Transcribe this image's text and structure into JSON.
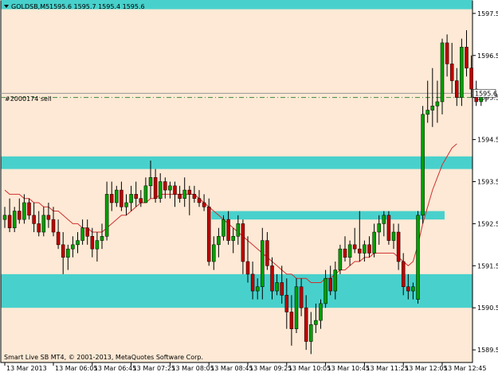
{
  "header": {
    "menu_icon": "triangle-down-icon",
    "symbol": "GOLDSB,M5",
    "ohlc": "1595.6 1595.7 1595.4 1595.6"
  },
  "footer": {
    "copyright": "Smart Live SB MT4, © 2001-2013, MetaQuotes Software Corp."
  },
  "trade_label": "#2000174 sell",
  "colors": {
    "background": "#fde9d5",
    "zone": "#48d1cc",
    "bull": "#00a000",
    "bear": "#c00000",
    "moving_average": "#d03030",
    "trade_line": "#3a8a3a",
    "bid_line": "#999999"
  },
  "chart_data": {
    "type": "candlestick",
    "ylim": [
      1589.2,
      1597.8
    ],
    "y_ticks": [
      "1597.5",
      "1596.5",
      "1595.5",
      "1594.5",
      "1593.5",
      "1592.5",
      "1591.5",
      "1590.5",
      "1589.5"
    ],
    "y_tick_values": [
      1597.5,
      1596.5,
      1595.5,
      1594.5,
      1593.5,
      1592.5,
      1591.5,
      1590.5,
      1589.5
    ],
    "x_ticks": [
      "13 Mar 2013",
      "13 Mar 06:05",
      "13 Mar 06:45",
      "13 Mar 07:25",
      "13 Mar 08:05",
      "13 Mar 08:45",
      "13 Mar 09:25",
      "13 Mar 10:05",
      "13 Mar 10:45",
      "13 Mar 11:25",
      "13 Mar 12:05",
      "13 Mar 12:45"
    ],
    "x_tick_bars": [
      0,
      10,
      18,
      26,
      34,
      42,
      50,
      58,
      66,
      74,
      82,
      90
    ],
    "current_price": 1595.6,
    "trade_price": 1595.5,
    "zones": [
      {
        "y1": 1597.6,
        "y2": 1597.9
      },
      {
        "y1": 1593.8,
        "y2": 1594.1
      },
      {
        "y1": 1591.3,
        "y2": 1590.5
      }
    ],
    "partial_zone": {
      "y1": 1592.6,
      "y2": 1592.8,
      "from_bar": 43,
      "to_bar": 90
    },
    "candles": [
      [
        1592.6,
        1592.9,
        1592.4,
        1592.7
      ],
      [
        1592.7,
        1593.1,
        1592.3,
        1592.4
      ],
      [
        1592.4,
        1592.9,
        1592.3,
        1592.8
      ],
      [
        1592.8,
        1593.1,
        1592.5,
        1592.6
      ],
      [
        1592.6,
        1593.2,
        1592.5,
        1593.0
      ],
      [
        1593.0,
        1593.1,
        1592.6,
        1592.7
      ],
      [
        1592.7,
        1593.0,
        1592.3,
        1592.5
      ],
      [
        1592.5,
        1592.8,
        1592.2,
        1592.3
      ],
      [
        1592.3,
        1592.9,
        1592.2,
        1592.7
      ],
      [
        1592.7,
        1593.0,
        1592.4,
        1592.6
      ],
      [
        1592.6,
        1592.9,
        1592.2,
        1592.3
      ],
      [
        1592.3,
        1592.6,
        1591.9,
        1592.0
      ],
      [
        1592.0,
        1592.3,
        1591.3,
        1591.7
      ],
      [
        1591.7,
        1592.0,
        1591.4,
        1591.9
      ],
      [
        1591.9,
        1592.2,
        1591.7,
        1592.0
      ],
      [
        1592.0,
        1592.3,
        1591.8,
        1592.1
      ],
      [
        1592.1,
        1592.6,
        1592.0,
        1592.4
      ],
      [
        1592.4,
        1592.6,
        1592.0,
        1592.2
      ],
      [
        1592.2,
        1592.4,
        1591.7,
        1591.9
      ],
      [
        1591.9,
        1592.3,
        1591.6,
        1592.1
      ],
      [
        1592.1,
        1592.5,
        1591.9,
        1592.2
      ],
      [
        1592.2,
        1593.5,
        1592.1,
        1593.2
      ],
      [
        1593.2,
        1593.5,
        1592.8,
        1593.0
      ],
      [
        1593.0,
        1593.4,
        1592.9,
        1593.3
      ],
      [
        1593.3,
        1593.5,
        1592.8,
        1592.9
      ],
      [
        1592.9,
        1593.2,
        1592.7,
        1593.0
      ],
      [
        1593.0,
        1593.4,
        1592.8,
        1593.2
      ],
      [
        1593.2,
        1593.5,
        1592.9,
        1593.1
      ],
      [
        1593.1,
        1593.3,
        1592.9,
        1593.0
      ],
      [
        1593.0,
        1593.6,
        1593.0,
        1593.4
      ],
      [
        1593.4,
        1594.0,
        1593.1,
        1593.6
      ],
      [
        1593.6,
        1593.8,
        1593.0,
        1593.1
      ],
      [
        1593.1,
        1593.7,
        1593.0,
        1593.5
      ],
      [
        1593.5,
        1593.6,
        1593.1,
        1593.3
      ],
      [
        1593.3,
        1593.5,
        1593.1,
        1593.4
      ],
      [
        1593.4,
        1593.5,
        1592.9,
        1593.2
      ],
      [
        1593.2,
        1593.4,
        1593.0,
        1593.1
      ],
      [
        1593.1,
        1593.6,
        1592.9,
        1593.3
      ],
      [
        1593.3,
        1593.4,
        1592.7,
        1593.2
      ],
      [
        1593.2,
        1593.4,
        1593.0,
        1593.1
      ],
      [
        1593.1,
        1593.3,
        1592.9,
        1593.0
      ],
      [
        1593.0,
        1593.2,
        1592.8,
        1592.9
      ],
      [
        1592.9,
        1593.1,
        1591.5,
        1591.6
      ],
      [
        1591.6,
        1592.2,
        1591.4,
        1592.0
      ],
      [
        1592.0,
        1592.4,
        1591.7,
        1592.2
      ],
      [
        1592.2,
        1592.7,
        1592.1,
        1592.6
      ],
      [
        1592.6,
        1592.8,
        1592.0,
        1592.1
      ],
      [
        1592.1,
        1592.4,
        1591.8,
        1592.2
      ],
      [
        1592.2,
        1592.7,
        1592.0,
        1592.5
      ],
      [
        1592.5,
        1592.6,
        1591.3,
        1591.6
      ],
      [
        1591.6,
        1592.2,
        1591.1,
        1591.3
      ],
      [
        1591.3,
        1591.6,
        1590.7,
        1590.9
      ],
      [
        1590.9,
        1591.2,
        1590.7,
        1591.0
      ],
      [
        1591.0,
        1592.4,
        1590.7,
        1592.1
      ],
      [
        1592.1,
        1592.3,
        1591.4,
        1591.5
      ],
      [
        1591.5,
        1591.7,
        1590.7,
        1590.9
      ],
      [
        1590.9,
        1591.3,
        1590.8,
        1591.1
      ],
      [
        1591.1,
        1591.5,
        1590.6,
        1590.8
      ],
      [
        1590.8,
        1591.2,
        1590.0,
        1590.4
      ],
      [
        1590.4,
        1590.8,
        1589.6,
        1590.0
      ],
      [
        1590.0,
        1591.2,
        1589.9,
        1591.0
      ],
      [
        1591.0,
        1591.2,
        1590.3,
        1590.5
      ],
      [
        1590.5,
        1590.8,
        1589.5,
        1589.7
      ],
      [
        1589.7,
        1590.4,
        1589.4,
        1590.1
      ],
      [
        1590.1,
        1590.6,
        1589.9,
        1590.2
      ],
      [
        1590.2,
        1590.7,
        1590.0,
        1590.6
      ],
      [
        1590.6,
        1591.4,
        1590.5,
        1591.2
      ],
      [
        1591.2,
        1591.5,
        1590.8,
        1590.9
      ],
      [
        1590.9,
        1591.6,
        1590.7,
        1591.4
      ],
      [
        1591.4,
        1592.0,
        1591.3,
        1591.9
      ],
      [
        1591.9,
        1592.2,
        1591.6,
        1591.7
      ],
      [
        1591.7,
        1592.1,
        1591.5,
        1592.0
      ],
      [
        1592.0,
        1592.4,
        1591.8,
        1591.9
      ],
      [
        1591.9,
        1592.8,
        1591.6,
        1591.8
      ],
      [
        1591.8,
        1592.1,
        1591.6,
        1592.0
      ],
      [
        1592.0,
        1592.2,
        1591.7,
        1591.8
      ],
      [
        1591.8,
        1592.5,
        1591.7,
        1592.3
      ],
      [
        1592.3,
        1592.7,
        1592.0,
        1592.5
      ],
      [
        1592.5,
        1592.8,
        1592.2,
        1592.7
      ],
      [
        1592.7,
        1592.8,
        1592.0,
        1592.1
      ],
      [
        1592.1,
        1592.5,
        1591.9,
        1592.3
      ],
      [
        1592.3,
        1592.5,
        1591.4,
        1591.6
      ],
      [
        1591.6,
        1591.8,
        1590.8,
        1591.0
      ],
      [
        1591.0,
        1591.3,
        1590.7,
        1590.9
      ],
      [
        1590.9,
        1591.1,
        1590.7,
        1591.0
      ],
      [
        1590.7,
        1592.8,
        1590.6,
        1592.7
      ],
      [
        1592.7,
        1595.3,
        1592.5,
        1595.1
      ],
      [
        1595.1,
        1595.9,
        1594.9,
        1595.2
      ],
      [
        1595.2,
        1596.2,
        1594.8,
        1595.3
      ],
      [
        1595.3,
        1595.9,
        1594.9,
        1595.4
      ],
      [
        1595.4,
        1596.9,
        1595.1,
        1596.8
      ],
      [
        1596.8,
        1597.0,
        1596.0,
        1596.3
      ],
      [
        1596.3,
        1596.8,
        1595.6,
        1595.9
      ],
      [
        1595.9,
        1596.2,
        1595.3,
        1595.5
      ],
      [
        1595.5,
        1596.9,
        1595.3,
        1596.7
      ],
      [
        1596.7,
        1597.1,
        1596.0,
        1596.2
      ],
      [
        1596.2,
        1596.5,
        1595.5,
        1595.7
      ],
      [
        1595.7,
        1595.9,
        1595.3,
        1595.4
      ],
      [
        1595.4,
        1595.7,
        1595.3,
        1595.6
      ],
      [
        1595.6,
        1595.7,
        1595.4,
        1595.6
      ]
    ],
    "moving_average": [
      1593.3,
      1593.2,
      1593.2,
      1593.2,
      1593.1,
      1593.1,
      1593.0,
      1593.0,
      1592.9,
      1592.9,
      1592.8,
      1592.8,
      1592.7,
      1592.6,
      1592.5,
      1592.5,
      1592.4,
      1592.4,
      1592.3,
      1592.3,
      1592.3,
      1592.4,
      1592.5,
      1592.6,
      1592.7,
      1592.7,
      1592.8,
      1592.9,
      1593.0,
      1593.0,
      1593.1,
      1593.1,
      1593.2,
      1593.2,
      1593.2,
      1593.2,
      1593.2,
      1593.2,
      1593.2,
      1593.2,
      1593.1,
      1593.0,
      1592.9,
      1592.8,
      1592.7,
      1592.6,
      1592.5,
      1592.4,
      1592.3,
      1592.2,
      1592.1,
      1592.0,
      1591.9,
      1591.8,
      1591.7,
      1591.6,
      1591.5,
      1591.4,
      1591.3,
      1591.3,
      1591.2,
      1591.2,
      1591.2,
      1591.1,
      1591.1,
      1591.1,
      1591.2,
      1591.2,
      1591.3,
      1591.4,
      1591.4,
      1591.5,
      1591.6,
      1591.6,
      1591.7,
      1591.7,
      1591.8,
      1591.8,
      1591.8,
      1591.8,
      1591.8,
      1591.7,
      1591.6,
      1591.5,
      1591.6,
      1592.0,
      1592.5,
      1592.9,
      1593.3,
      1593.6,
      1593.9,
      1594.1,
      1594.3,
      1594.4
    ]
  }
}
